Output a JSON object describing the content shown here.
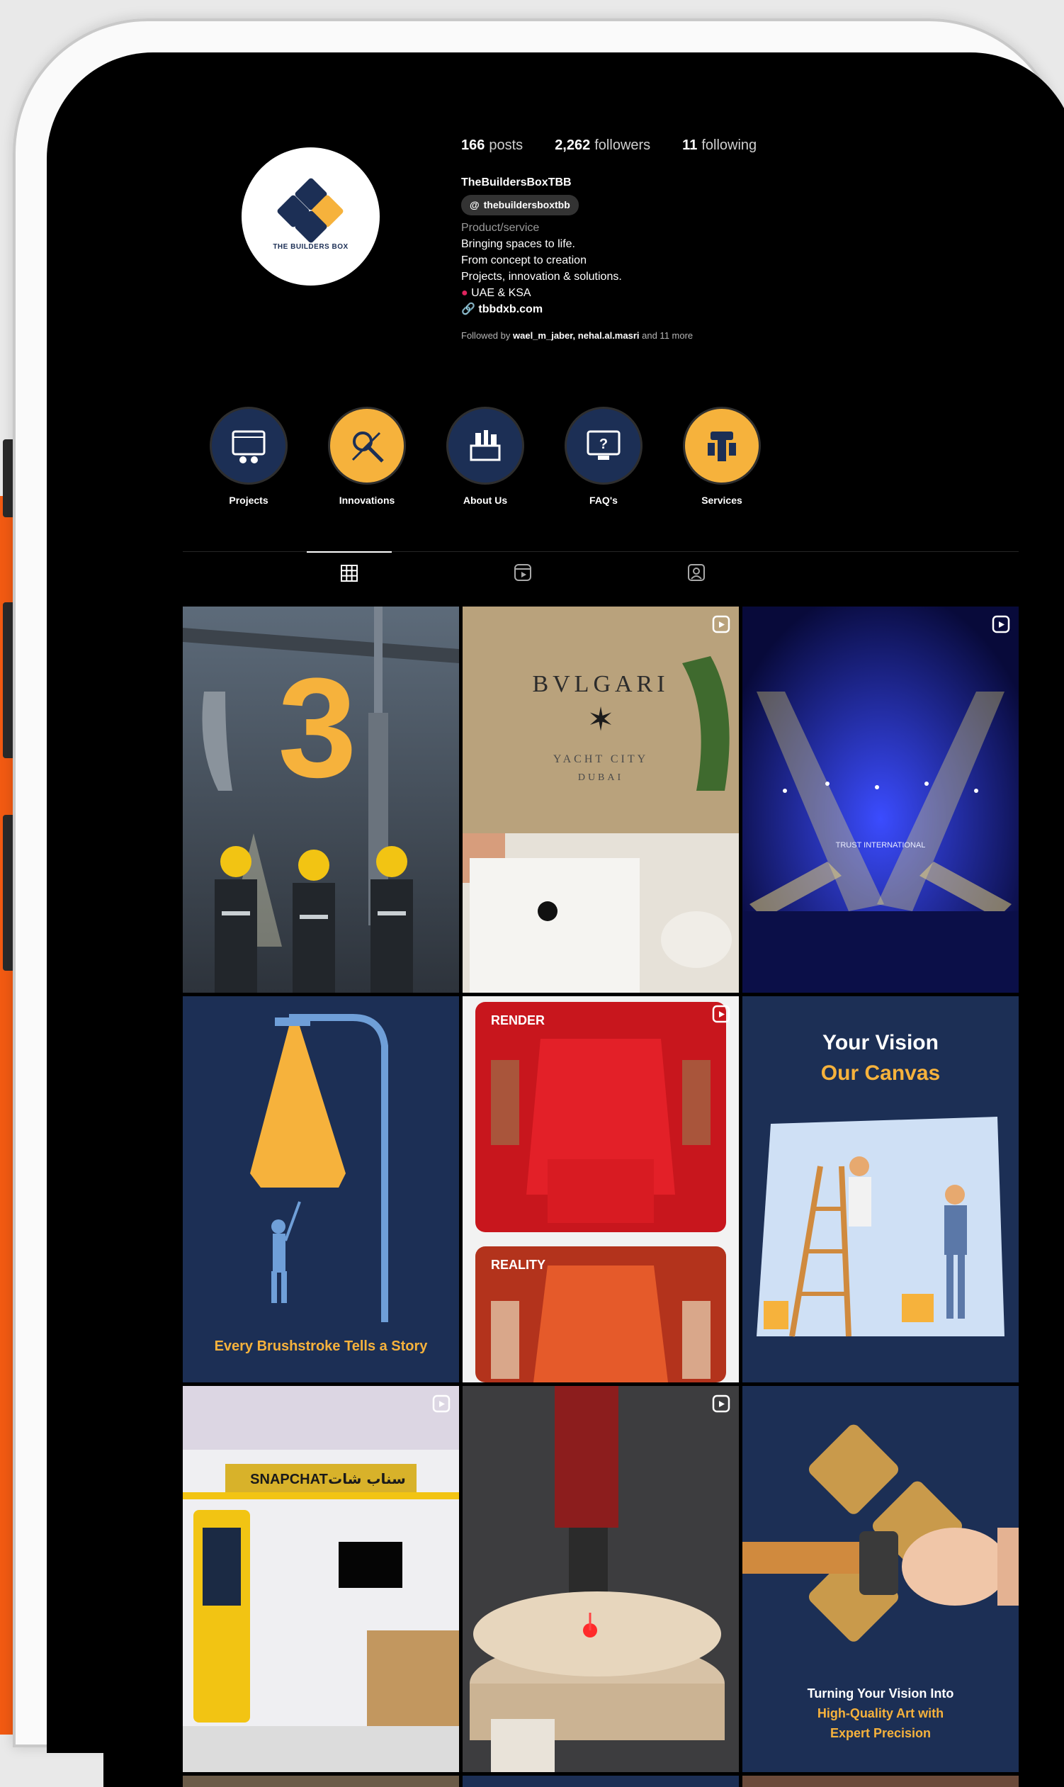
{
  "profile": {
    "posts_count": "166",
    "posts_label": "posts",
    "followers_count": "2,262",
    "followers_label": "followers",
    "following_count": "11",
    "following_label": "following",
    "username": "TheBuildersBoxTBB",
    "threads_handle": "thebuildersboxtbb",
    "category": "Product/service",
    "bio_lines": [
      "Bringing spaces to life.",
      "From concept to creation",
      "Projects, innovation & solutions."
    ],
    "location": "UAE & KSA",
    "website": "tbbdxb.com",
    "followed_by_prefix": "Followed by",
    "followed_by_users": "wael_m_jaber, nehal.al.masri",
    "followed_by_suffix": "and 11 more",
    "avatar_text": "THE BUILDERS BOX"
  },
  "highlights": [
    {
      "label": "Projects",
      "icon": "projects-icon",
      "ring_color": "#1c2f55"
    },
    {
      "label": "Innovations",
      "icon": "innovations-icon",
      "ring_color": "#f6b23c"
    },
    {
      "label": "About Us",
      "icon": "about-us-icon",
      "ring_color": "#1c2f55"
    },
    {
      "label": "FAQ's",
      "icon": "faq-icon",
      "ring_color": "#1c2f55"
    },
    {
      "label": "Services",
      "icon": "services-icon",
      "ring_color": "#f6b23c"
    }
  ],
  "tabs": [
    {
      "name": "posts-grid-tab",
      "icon": "grid-icon"
    },
    {
      "name": "reels-tab",
      "icon": "reels-icon"
    },
    {
      "name": "tagged-tab",
      "icon": "tagged-icon"
    }
  ],
  "posts": [
    {
      "name": "post-3-workers",
      "big_number": "3",
      "reel": false
    },
    {
      "name": "post-bvlgari",
      "sign_line1": "BVLGARI",
      "sign_line2": "YACHT CITY",
      "sign_line3": "DUBAI",
      "reel": true
    },
    {
      "name": "post-concert-stage",
      "stage_text": "TRUST INTERNATIONAL",
      "reel": true
    },
    {
      "name": "post-brushstroke",
      "caption": "Every Brushstroke Tells a Story",
      "reel": false
    },
    {
      "name": "post-render-reality",
      "label_top": "RENDER",
      "label_bottom": "REALITY",
      "reel": true
    },
    {
      "name": "post-your-vision",
      "line1": "Your Vision",
      "line2": "Our Canvas",
      "reel": false
    },
    {
      "name": "post-snapchat-booth",
      "sign": "SNAPCHAT",
      "sign_arabic": "سناب شات",
      "reel": true
    },
    {
      "name": "post-laser-engraving",
      "reel": true
    },
    {
      "name": "post-turning-vision",
      "caption": "Turning Your Vision Into High-Quality Art with Expert Precision",
      "reel": false
    }
  ],
  "colors": {
    "navy": "#1c2f55",
    "gold": "#f6b23c",
    "accent_orange": "#f25a12"
  }
}
